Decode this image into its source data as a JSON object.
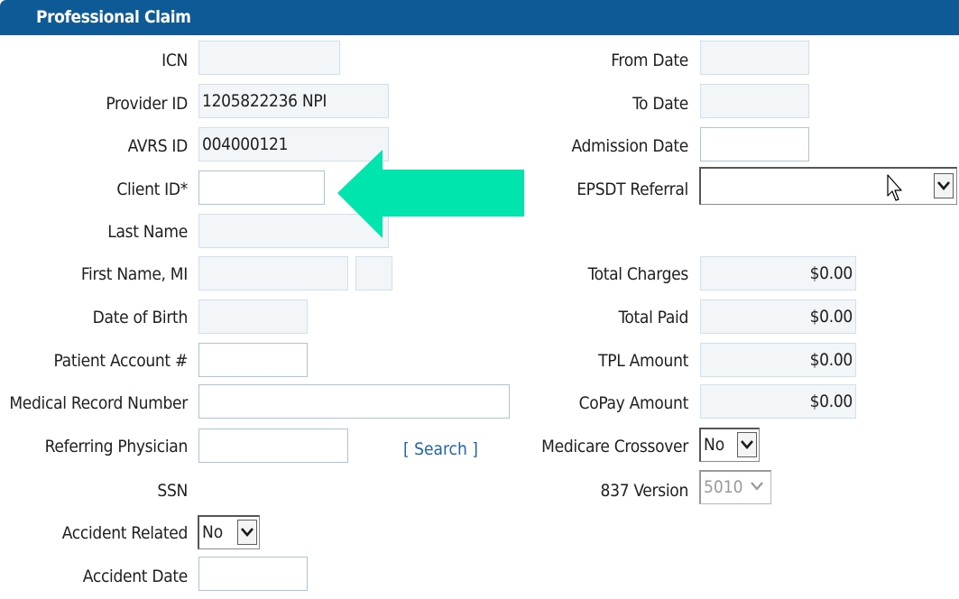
{
  "header": {
    "title": "Professional Claim"
  },
  "left_fields": {
    "icn": {
      "label": "ICN",
      "value": ""
    },
    "provider_id": {
      "label": "Provider ID",
      "value": "1205822236 NPI"
    },
    "avrs_id": {
      "label": "AVRS ID",
      "value": "004000121"
    },
    "client_id": {
      "label": "Client ID*",
      "value": ""
    },
    "last_name": {
      "label": "Last Name",
      "value": ""
    },
    "first_name": {
      "label": "First Name, MI",
      "value": "",
      "mi": ""
    },
    "dob": {
      "label": "Date of Birth",
      "value": ""
    },
    "patient_account": {
      "label": "Patient Account #",
      "value": ""
    },
    "medical_record": {
      "label": "Medical Record Number",
      "value": ""
    },
    "referring_physician": {
      "label": "Referring Physician",
      "value": "",
      "search_link": "[ Search ]"
    },
    "ssn": {
      "label": "SSN"
    },
    "accident_related": {
      "label": "Accident Related",
      "value": "No"
    },
    "accident_date": {
      "label": "Accident Date",
      "value": ""
    }
  },
  "right_fields": {
    "from_date": {
      "label": "From Date",
      "value": ""
    },
    "to_date": {
      "label": "To Date",
      "value": ""
    },
    "admission_date": {
      "label": "Admission Date",
      "value": ""
    },
    "epsdt_referral": {
      "label": "EPSDT Referral",
      "value": ""
    },
    "total_charges": {
      "label": "Total Charges",
      "value": "$0.00"
    },
    "total_paid": {
      "label": "Total Paid",
      "value": "$0.00"
    },
    "tpl_amount": {
      "label": "TPL Amount",
      "value": "$0.00"
    },
    "copay_amount": {
      "label": "CoPay Amount",
      "value": "$0.00"
    },
    "medicare_crossover": {
      "label": "Medicare Crossover",
      "value": "No"
    },
    "version_837": {
      "label": "837 Version",
      "value": "5010"
    }
  },
  "colors": {
    "header_bg": "#0e5a96",
    "arrow": "#00e5ad",
    "link": "#1f64b3"
  },
  "icons": [
    "chevron-down-icon",
    "arrow-left-icon",
    "mouse-pointer-icon"
  ]
}
